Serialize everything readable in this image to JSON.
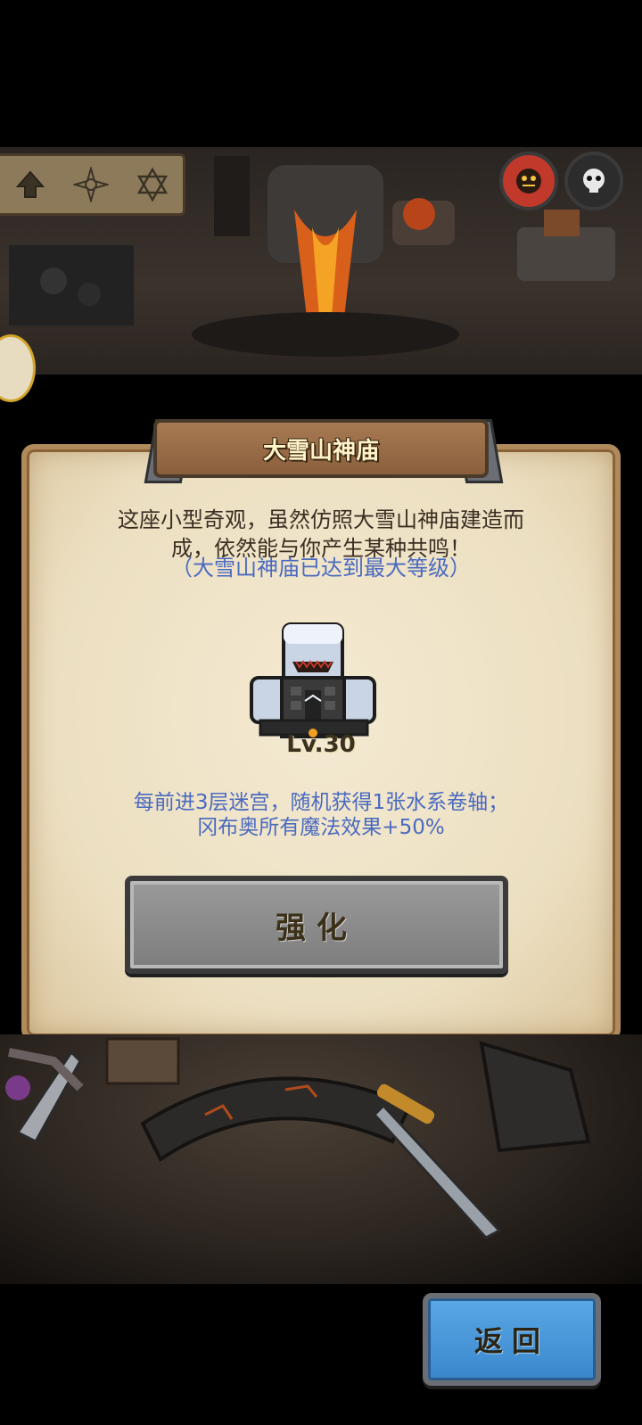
{
  "header": {
    "tabs": [
      {
        "icon": "arrow-up-icon"
      },
      {
        "icon": "sun-star-icon"
      },
      {
        "icon": "hexagram-icon"
      }
    ],
    "round_buttons": [
      {
        "icon": "demon-face-icon",
        "color": "#c0392b"
      },
      {
        "icon": "skull-face-icon",
        "color": "#2c2c2c"
      }
    ]
  },
  "panel": {
    "title": "大雪山神庙",
    "description_line1": "这座小型奇观，虽然仿照大雪山神庙建造而",
    "description_line2": "成，依然能与你产生某种共鸣！",
    "max_level_note": "（大雪山神庙已达到最大等级）",
    "building_icon": "snow-temple-icon",
    "level_text": "Lv.30",
    "effect_line1": "每前进3层迷宫，随机获得1张水系卷轴；",
    "effect_line2": "冈布奥所有魔法效果+50%",
    "upgrade_button": "强化"
  },
  "footer": {
    "back_button": "返回"
  },
  "colors": {
    "accent_blue": "#4a6ac0",
    "parchment": "#efe3c6",
    "back_button": "#4a98da"
  }
}
